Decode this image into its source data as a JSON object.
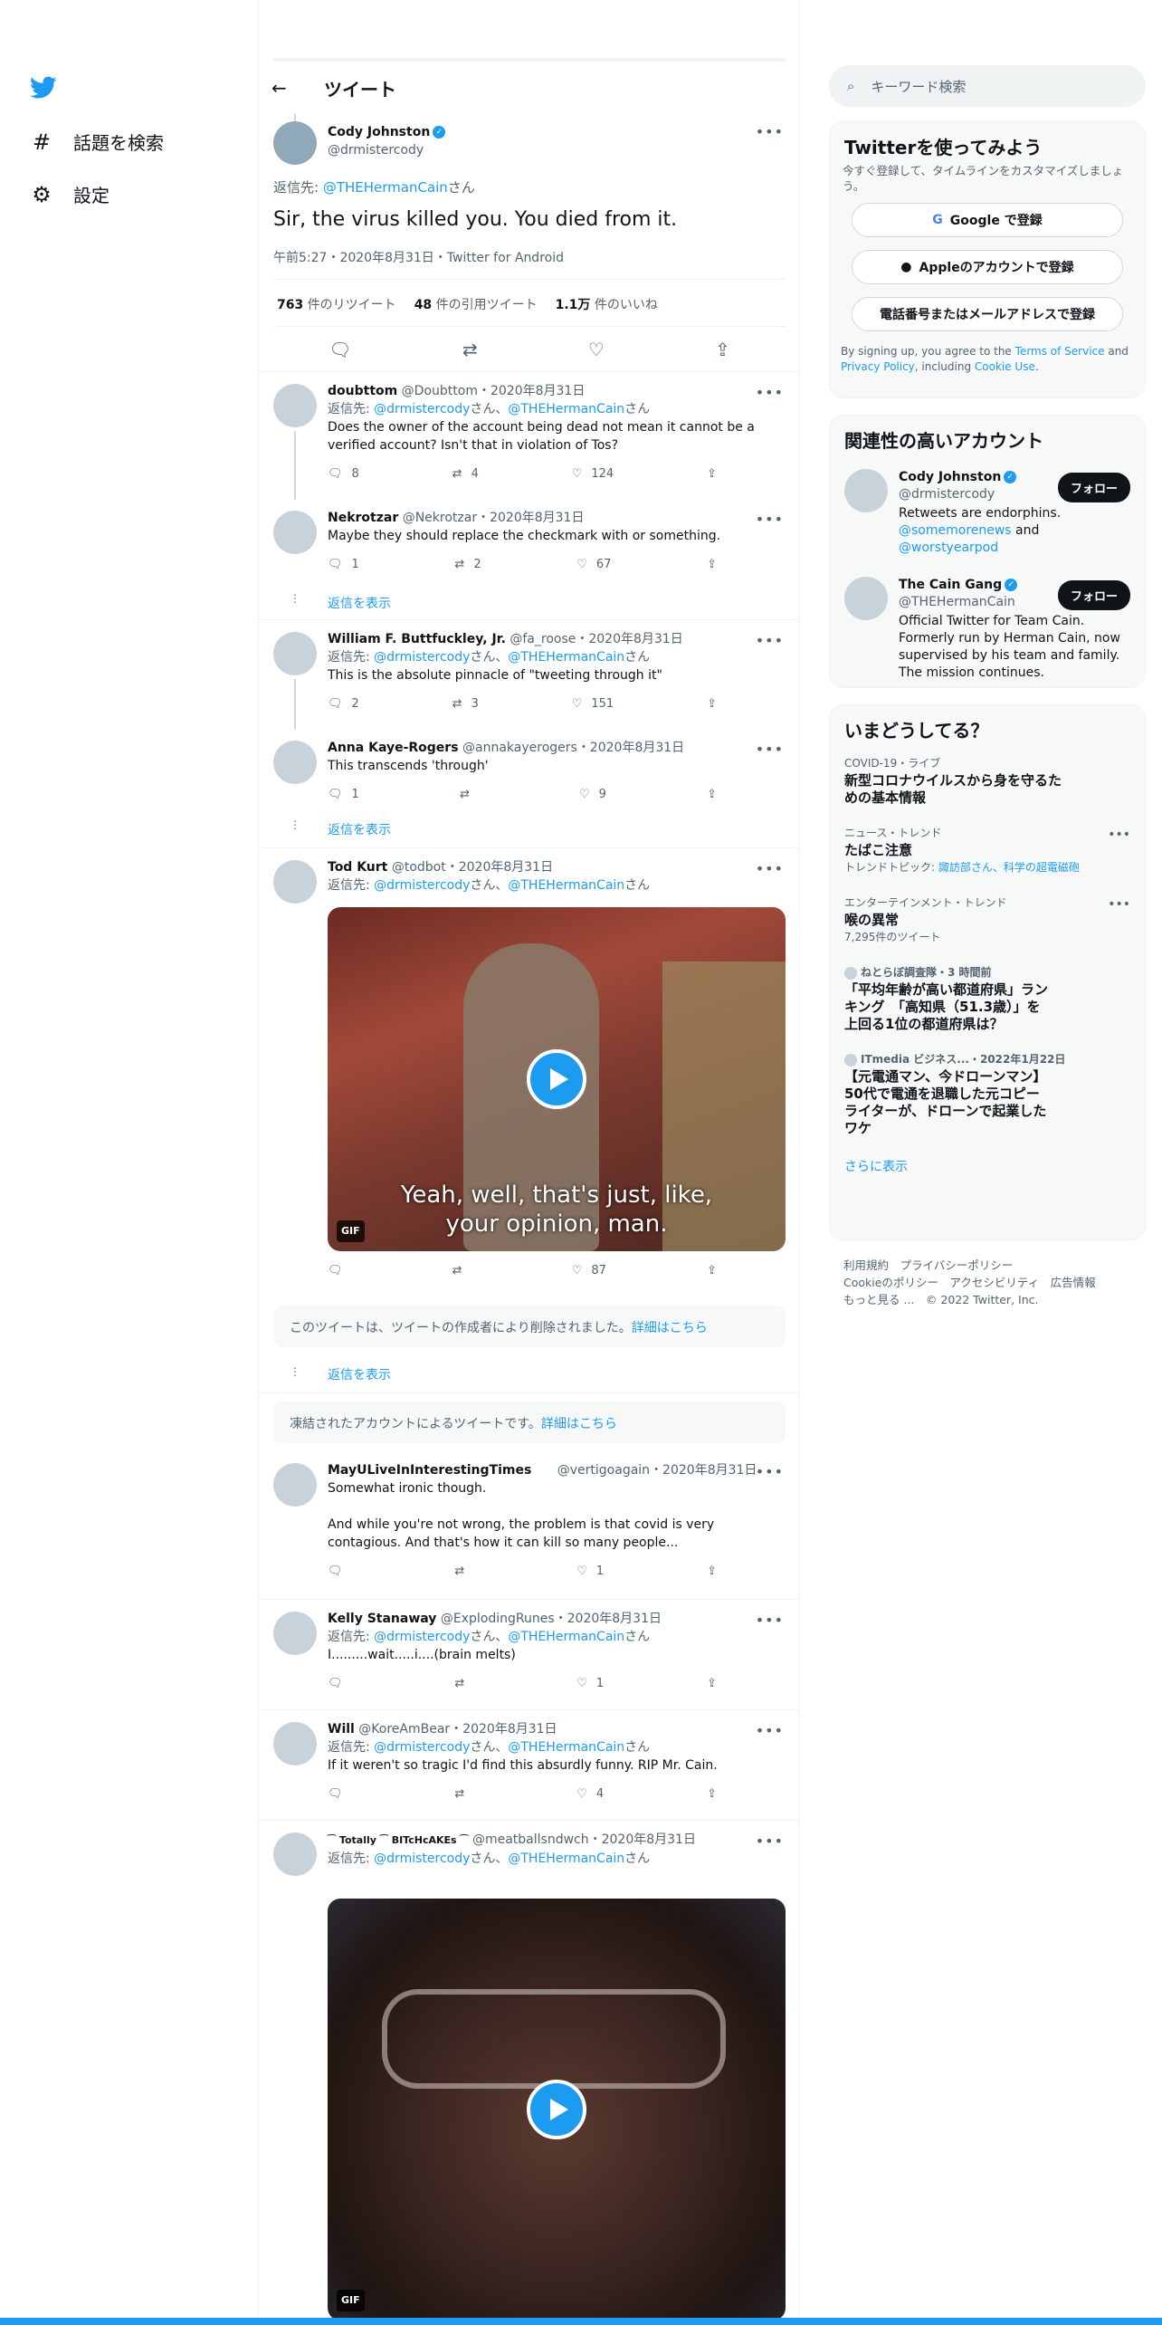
{
  "nav": {
    "explore": "話題を検索",
    "settings": "設定"
  },
  "header": {
    "back": "←",
    "title": "ツイート"
  },
  "tweet": {
    "name": "Cody Johnston",
    "handle": "@drmistercody",
    "reply_prefix": "返信先: ",
    "reply_to": "@THEHermanCain",
    "reply_suffix": "さん",
    "text": "Sir, the virus killed you. You died from it.",
    "meta": "午前5:27・2020年8月31日・Twitter for Android",
    "retweets": "763",
    "retweets_label": "件のリツイート",
    "quotes": "48",
    "quotes_label": "件の引用ツイート",
    "likes": "1.1万",
    "likes_label": "件のいいね"
  },
  "replies": [
    {
      "name": "doubttom",
      "handle": "@Doubttom",
      "date": "・2020年8月31日",
      "reply_to": [
        "@drmistercody",
        "@THEHermanCain"
      ],
      "text": "Does the owner of the account being dead not mean it cannot be a verified account? Isn't that in violation of Tos?",
      "reply": "8",
      "rt": "4",
      "like": "124"
    },
    {
      "name": "Nekrotzar",
      "handle": "@Nekrotzar",
      "date": "・2020年8月31日",
      "text": "Maybe they should replace the checkmark with      or something.",
      "reply": "1",
      "rt": "2",
      "like": "67"
    },
    {
      "name": "William F. Buttfuckley, Jr.",
      "handle": "@fa_roose",
      "date": "・2020年8月31日",
      "reply_to": [
        "@drmistercody",
        "@THEHermanCain"
      ],
      "text": "This is the absolute pinnacle of \"tweeting through it\"",
      "reply": "2",
      "rt": "3",
      "like": "151"
    },
    {
      "name": "Anna Kaye-Rogers",
      "handle": "@annakayerogers",
      "date": "・2020年8月31日",
      "text": "This transcends 'through'",
      "reply": "1",
      "rt": "",
      "like": "9"
    },
    {
      "name": "Tod Kurt",
      "handle": "@todbot",
      "date": "・2020年8月31日",
      "reply_to": [
        "@drmistercody",
        "@THEHermanCain"
      ],
      "gif_caption_1": "Yeah, well, that's just, like,",
      "gif_caption_2": "your opinion, man.",
      "gif": "GIF",
      "reply": "",
      "rt": "",
      "like": "87"
    },
    {
      "name": "MayULiveInInterestingTimes",
      "handle": "@vertigoagain",
      "date": "・2020年8月31日",
      "text": "Somewhat ironic though.",
      "text2": "And while you're not wrong, the problem is that covid is very contagious. And that's how it can kill so many people...",
      "reply": "",
      "rt": "",
      "like": "1"
    },
    {
      "name": "Kelly Stanaway",
      "handle": "@ExplodingRunes",
      "date": "・2020年8月31日",
      "reply_to": [
        "@drmistercody",
        "@THEHermanCain"
      ],
      "text": "I.........wait.....i....(brain melts)",
      "reply": "",
      "rt": "",
      "like": "1"
    },
    {
      "name": "Will",
      "handle": "@KoreAmBear",
      "date": "・2020年8月31日",
      "reply_to": [
        "@drmistercody",
        "@THEHermanCain"
      ],
      "text": "If it weren't so tragic I'd find this absurdly funny. RIP Mr. Cain.",
      "reply": "",
      "rt": "",
      "like": "4"
    },
    {
      "name": "⁀ Totally ⁀ BITcHcAKEs ⁀",
      "handle": "@meatballsndwch",
      "date": "・2020年8月31日",
      "reply_to": [
        "@drmistercody",
        "@THEHermanCain"
      ],
      "gif": "GIF"
    }
  ],
  "reply_common": {
    "prefix": "返信先: ",
    "san": "さん",
    "comma": "、"
  },
  "show_replies": "返信を表示",
  "deleted_notice": {
    "text": "このツイートは、ツイートの作成者により削除されました。",
    "link": "詳細はこちら"
  },
  "suspended_notice": {
    "text": "凍結されたアカウントによるツイートです。",
    "link": "詳細はこちら"
  },
  "search": {
    "placeholder": "キーワード検索"
  },
  "signup": {
    "title": "Twitterを使ってみよう",
    "subtitle": "今すぐ登録して、タイムラインをカスタマイズしましょう。",
    "google": "Google で登録",
    "apple": "Appleのアカウントで登録",
    "phone": "電話番号またはメールアドレスで登録",
    "legal_1": "By signing up, you agree to the ",
    "terms": "Terms of Service",
    "legal_2": " and ",
    "privacy": "Privacy Policy",
    "legal_3": ", including ",
    "cookie": "Cookie Use",
    "legal_4": "."
  },
  "relevant": {
    "title": "関連性の高いアカウント",
    "follow": "フォロー",
    "accounts": [
      {
        "name": "Cody Johnston",
        "handle": "@drmistercody",
        "bio_1": "Retweets are endorphins.",
        "bio_link1": "@somemorenews",
        "bio_and": " and ",
        "bio_link2": "@worstyearpod"
      },
      {
        "name": "The Cain Gang",
        "handle": "@THEHermanCain",
        "bio": "Official Twitter for Team Cain. Formerly run by Herman Cain, now supervised by his team and family. The mission continues."
      }
    ]
  },
  "trends": {
    "title": "いまどうしてる？",
    "items": [
      {
        "cat": "COVID-19・ライブ",
        "title": "新型コロナウイルスから身を守るための基本情報"
      },
      {
        "cat": "ニュース・トレンド",
        "title": "たばこ注意",
        "sub_prefix": "トレンドトピック: ",
        "sub_link": "諏訪部さん、科学の超電磁砲"
      },
      {
        "cat": "エンターテインメント・トレンド",
        "title": "喉の異常",
        "sub": "7,295件のツイート"
      },
      {
        "cat": "ねとらぼ調査隊・3 時間前",
        "title": "「平均年齢が高い都道府県」ランキング　「高知県（51.3歳）」を上回る1位の都道府県は？"
      },
      {
        "cat": "ITmedia ビジネス...・2022年1月22日",
        "title": "【元電通マン、今ドローンマン】50代で電通を退職した元コピーライターが、ドローンで起業したワケ"
      }
    ],
    "more": "さらに表示"
  },
  "footer": {
    "terms": "利用規約",
    "privacy": "プライバシーポリシー",
    "cookie": "Cookieのポリシー",
    "access": "アクセシビリティ",
    "ads": "広告情報",
    "more": "もっと見る ...",
    "copy": "© 2022 Twitter, Inc."
  }
}
